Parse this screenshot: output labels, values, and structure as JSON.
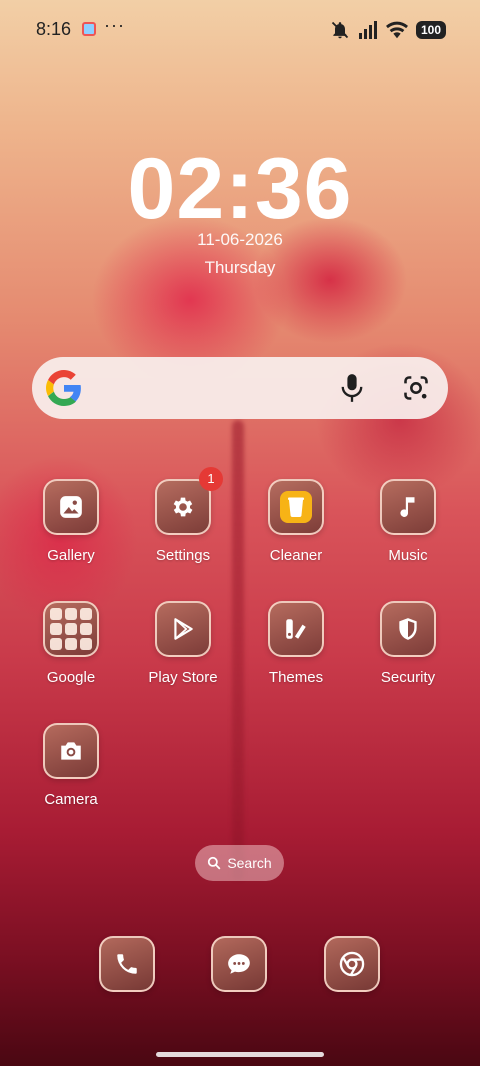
{
  "status_bar": {
    "time": "8:16",
    "more": "···",
    "battery": "100",
    "icons": [
      "app-notification-icon",
      "muted-icon",
      "signal-icon",
      "wifi-icon",
      "battery-icon"
    ]
  },
  "clock": {
    "time": "02:36",
    "date": "11-06-2026",
    "weekday": "Thursday"
  },
  "search_widget": {
    "icons": [
      "google-logo-icon",
      "microphone-icon",
      "google-lens-icon"
    ]
  },
  "apps": [
    {
      "label": "Gallery",
      "icon": "gallery-icon"
    },
    {
      "label": "Settings",
      "icon": "gear-icon",
      "badge": "1"
    },
    {
      "label": "Cleaner",
      "icon": "trash-icon"
    },
    {
      "label": "Music",
      "icon": "music-note-icon"
    },
    {
      "label": "Google",
      "icon": "folder-icon"
    },
    {
      "label": "Play Store",
      "icon": "play-store-icon"
    },
    {
      "label": "Themes",
      "icon": "themes-icon"
    },
    {
      "label": "Security",
      "icon": "shield-icon"
    },
    {
      "label": "Camera",
      "icon": "camera-icon"
    }
  ],
  "app_search": {
    "label": "Search"
  },
  "dock": [
    {
      "icon": "phone-icon"
    },
    {
      "icon": "messages-icon"
    },
    {
      "icon": "chrome-icon"
    }
  ],
  "colors": {
    "accent_badge": "#e53935",
    "cleaner_yellow": "#f7b316"
  }
}
